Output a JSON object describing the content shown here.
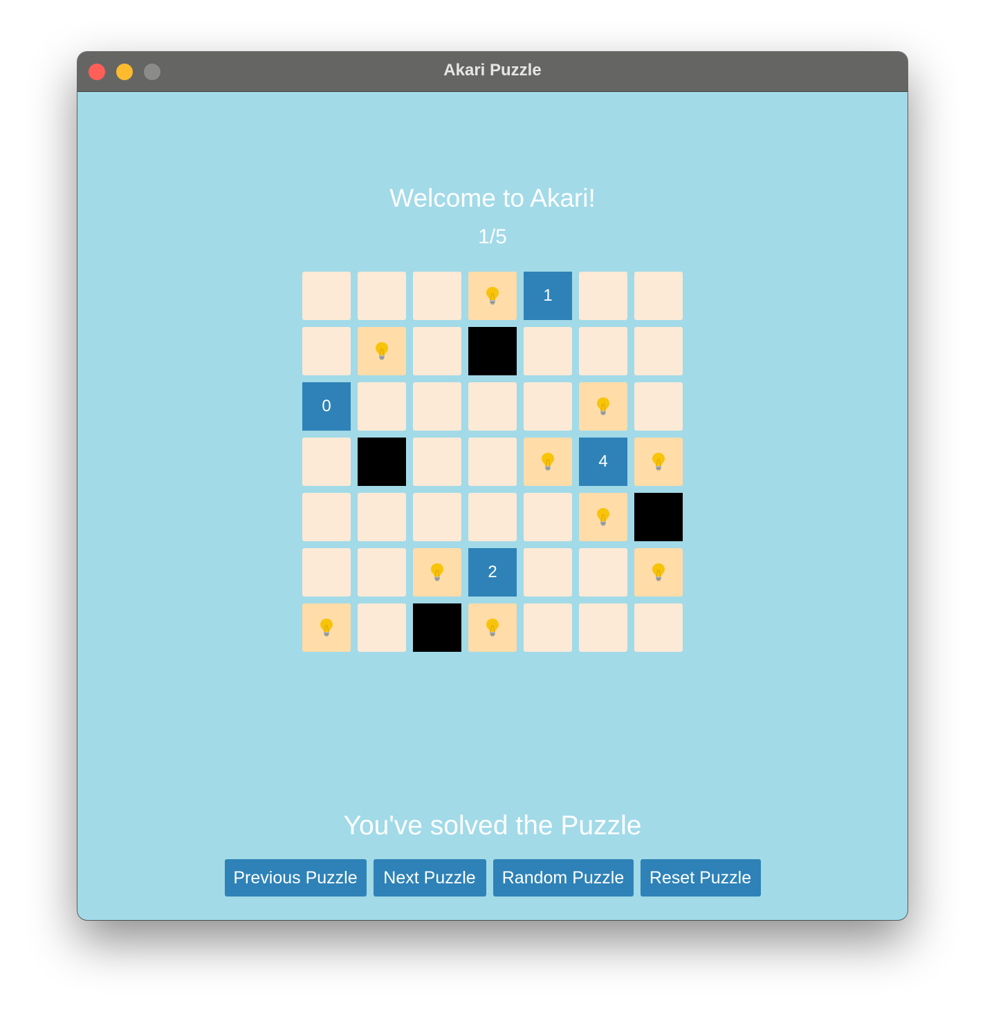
{
  "window": {
    "title": "Akari Puzzle"
  },
  "header": {
    "heading": "Welcome to Akari!",
    "counter": "1/5"
  },
  "board": {
    "size": 7,
    "rows": [
      [
        "empty",
        "empty",
        "empty",
        "lamp",
        "clue:1",
        "empty",
        "empty"
      ],
      [
        "empty",
        "lamp",
        "empty",
        "wall",
        "empty",
        "empty",
        "empty"
      ],
      [
        "clue:0",
        "empty",
        "empty",
        "empty",
        "empty",
        "lamp",
        "empty"
      ],
      [
        "empty",
        "wall",
        "empty",
        "empty",
        "lamp",
        "clue:4",
        "lamp"
      ],
      [
        "empty",
        "empty",
        "empty",
        "empty",
        "empty",
        "lamp",
        "wall"
      ],
      [
        "empty",
        "empty",
        "lamp",
        "clue:2",
        "empty",
        "empty",
        "lamp"
      ],
      [
        "lamp",
        "empty",
        "wall",
        "lamp",
        "empty",
        "empty",
        "empty"
      ]
    ],
    "lamp_icon": "lightbulb-icon"
  },
  "status": {
    "message": "You've solved the Puzzle"
  },
  "controls": {
    "previous_label": "Previous Puzzle",
    "next_label": "Next Puzzle",
    "random_label": "Random Puzzle",
    "reset_label": "Reset Puzzle"
  },
  "colors": {
    "background": "#a2dae8",
    "empty_cell": "#fcead6",
    "lit_lamp_cell": "#ffdca8",
    "clue_cell": "#2e82b7",
    "wall_cell": "#000000",
    "button": "#2e82b7"
  }
}
